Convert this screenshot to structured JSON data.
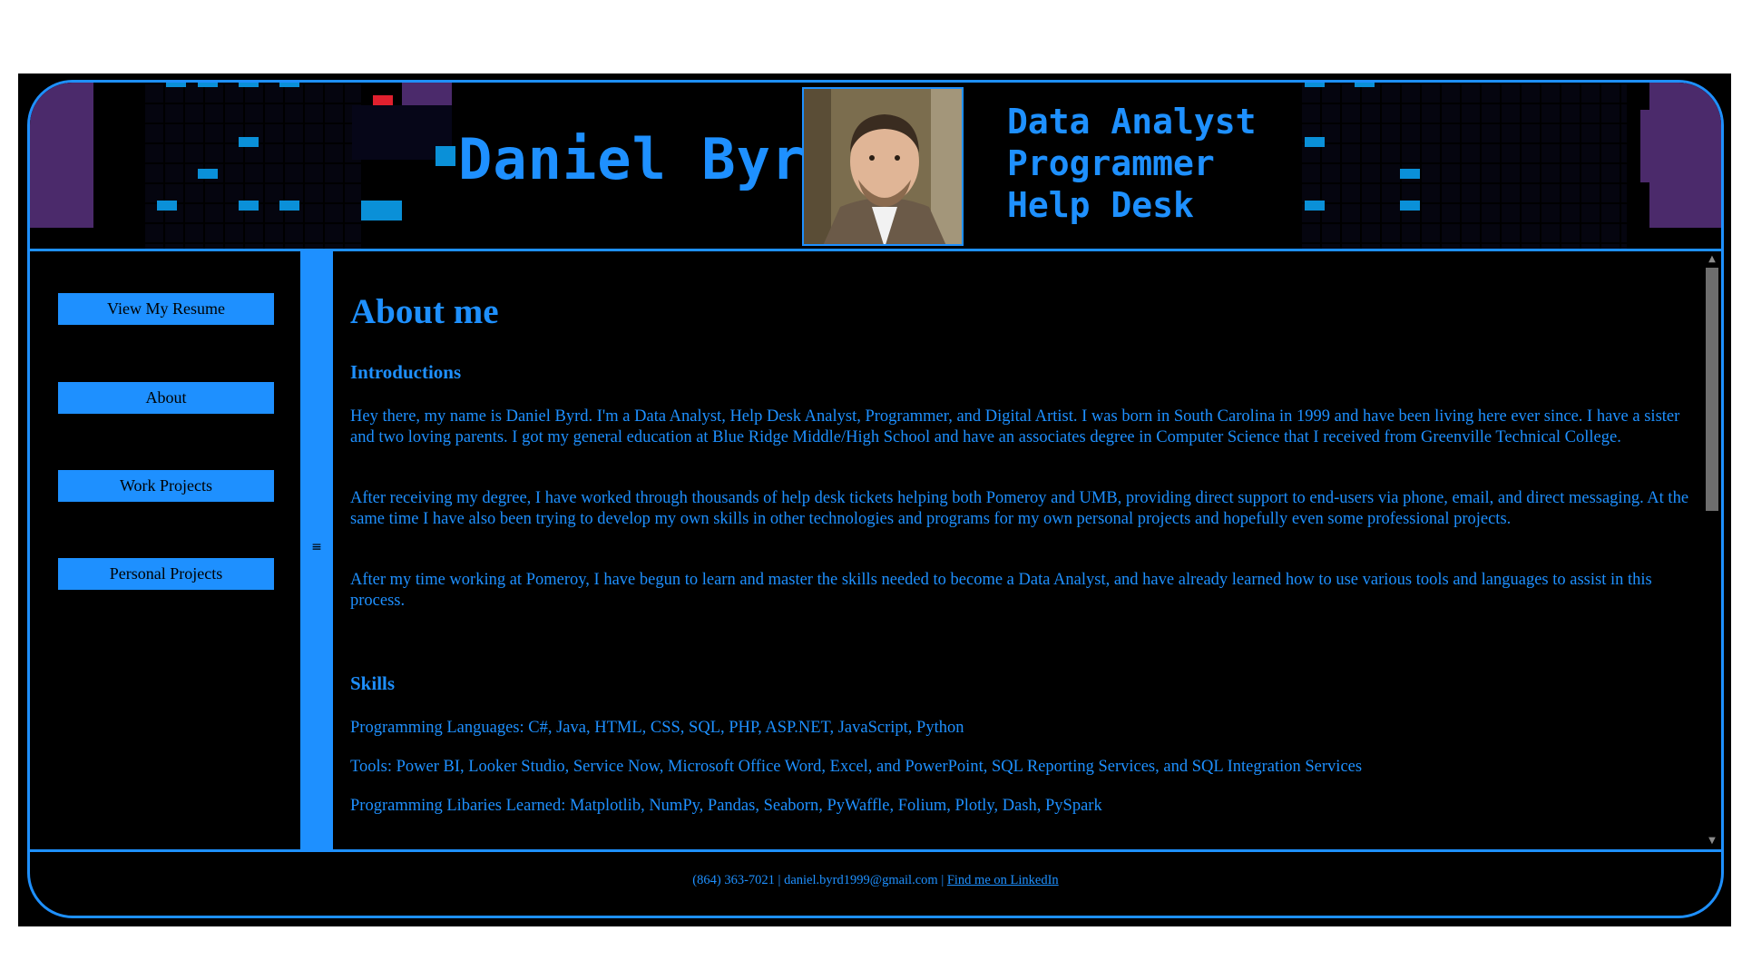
{
  "header": {
    "name": "Daniel Byrd",
    "roles": [
      "Data Analyst",
      "Programmer",
      "Help Desk"
    ]
  },
  "sidebar": {
    "buttons": [
      "View My Resume",
      "About",
      "Work Projects",
      "Personal Projects"
    ],
    "splitter_glyph": "≡"
  },
  "main": {
    "title": "About me",
    "intro_heading": "Introductions",
    "paragraphs": [
      "Hey there, my name is Daniel Byrd. I'm a Data Analyst, Help Desk Analyst, Programmer, and Digital Artist. I was born in South Carolina in 1999 and have been living here ever since. I have a sister and two loving parents. I got my general education at Blue Ridge Middle/High School and have an associates degree in Computer Science that I received from Greenville Technical College.",
      "After receiving my degree, I have worked through thousands of help desk tickets helping both Pomeroy and UMB, providing direct support to end-users via phone, email, and direct messaging. At the same time I have also been trying to develop my own skills in other technologies and programs for my own personal projects and hopefully even some professional projects.",
      "After my time working at Pomeroy, I have begun to learn and master the skills needed to become a Data Analyst, and have already learned how to use various tools and languages to assist in this process."
    ],
    "skills_heading": "Skills",
    "skills": [
      "Programming Languages: C#, Java, HTML, CSS, SQL, PHP, ASP.NET, JavaScript, Python",
      "Tools: Power BI, Looker Studio, Service Now, Microsoft Office Word, Excel, and PowerPoint, SQL Reporting Services, and SQL Integration Services",
      "Programming Libaries Learned: Matplotlib, NumPy, Pandas, Seaborn, PyWaffle, Folium, Plotly, Dash, PySpark"
    ]
  },
  "footer": {
    "phone": "(864) 363-7021",
    "separator": " | ",
    "email": "daniel.byrd1999@gmail.com",
    "linkedin_label": "Find me on LinkedIn"
  },
  "colors": {
    "accent": "#1e90ff",
    "background": "#000000",
    "header_purple": "#4b2a6b"
  },
  "icons": {
    "splitter": "splitter-grip-icon",
    "scroll_up": "scroll-up-arrow-icon",
    "scroll_down": "scroll-down-arrow-icon"
  }
}
